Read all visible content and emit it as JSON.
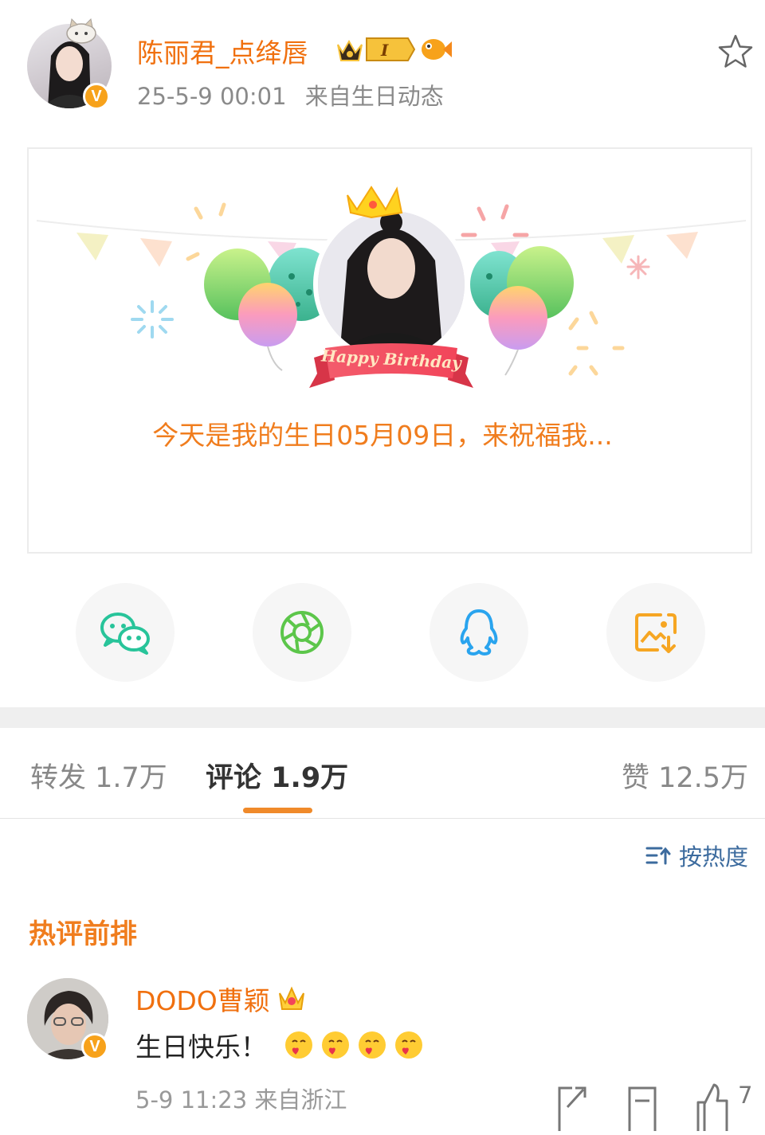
{
  "post": {
    "username": "陈丽君_点绛唇",
    "timestamp": "25-5-9 00:01",
    "source": "来自生日动态"
  },
  "card": {
    "banner_label": "Happy Birthday",
    "message": "今天是我的生日05月09日，来祝福我..."
  },
  "share": [
    "wechat-icon",
    "moments-icon",
    "qq-icon",
    "save-image-icon"
  ],
  "tabs": {
    "repost": "转发 1.7万",
    "comment": "评论 1.9万",
    "like": "赞 12.5万"
  },
  "sort_label": "按热度",
  "hot_title": "热评前排",
  "comment": {
    "name": "DODO曹颖",
    "text": "生日快乐！",
    "meta": "5-9 11:23  来自浙江",
    "like_count": "7"
  },
  "colors": {
    "accent_orange": "#f0700f",
    "sort_blue": "#3c6b9e",
    "verified_badge": "#f7a21b"
  }
}
